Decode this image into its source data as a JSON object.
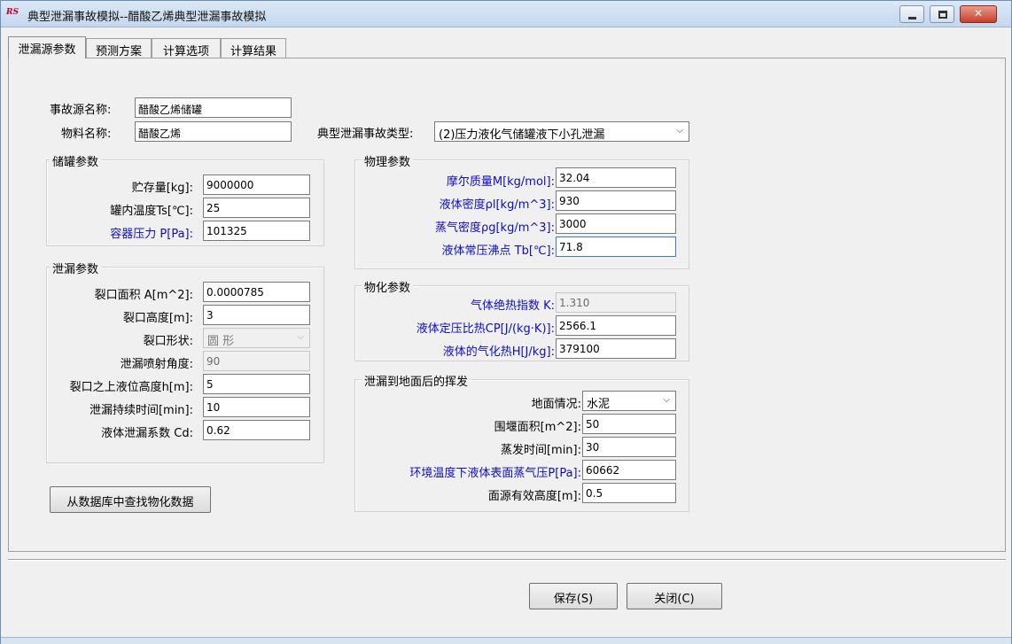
{
  "window": {
    "title": "典型泄漏事故模拟--醋酸乙烯典型泄漏事故模拟",
    "icon_text": "RS",
    "minimize_icon": "minimize-icon",
    "maximize_icon": "maximize-icon",
    "close_icon": "close-icon",
    "close_glyph": "✕"
  },
  "tabs": [
    {
      "label": "泄漏源参数",
      "active": true
    },
    {
      "label": "预测方案",
      "active": false
    },
    {
      "label": "计算选项",
      "active": false
    },
    {
      "label": "计算结果",
      "active": false
    }
  ],
  "source": {
    "name_label": "事故源名称:",
    "name_value": "醋酸乙烯储罐",
    "material_label": "物料名称:",
    "material_value": "醋酸乙烯",
    "accident_type_label": "典型泄漏事故类型:",
    "accident_type_value": "(2)压力液化气储罐液下小孔泄漏"
  },
  "tank": {
    "title": "储罐参数",
    "fields": [
      {
        "label": "贮存量[kg]:",
        "value": "9000000",
        "blue": false
      },
      {
        "label": "罐内温度Ts[℃]:",
        "value": "25",
        "blue": false
      },
      {
        "label": "容器压力 P[Pa]:",
        "value": "101325",
        "blue": true
      }
    ]
  },
  "leak": {
    "title": "泄漏参数",
    "fields": [
      {
        "label": "裂口面积 A[m^2]:",
        "value": "0.0000785"
      },
      {
        "label": "裂口高度[m]:",
        "value": "3"
      },
      {
        "label": "裂口形状:",
        "value": "圆  形"
      },
      {
        "label": "泄漏喷射角度:",
        "value": "90"
      },
      {
        "label": "裂口之上液位高度h[m]:",
        "value": "5"
      },
      {
        "label": "泄漏持续时间[min]:",
        "value": "10"
      },
      {
        "label": "液体泄漏系数  Cd:",
        "value": "0.62"
      }
    ]
  },
  "physical": {
    "title": "物理参数",
    "fields": [
      {
        "label": "摩尔质量M[kg/mol]:",
        "value": "32.04"
      },
      {
        "label": "液体密度ρl[kg/m^3]:",
        "value": "930"
      },
      {
        "label": "蒸气密度ρg[kg/m^3]:",
        "value": "3000"
      },
      {
        "label": "液体常压沸点 Tb[℃]:",
        "value": "71.8"
      }
    ]
  },
  "chemical": {
    "title": "物化参数",
    "fields": [
      {
        "label": "气体绝热指数  K:",
        "value": "1.310"
      },
      {
        "label": "液体定压比热CP[J/(kg·K)]:",
        "value": "2566.1"
      },
      {
        "label": "液体的气化热H[J/kg]:",
        "value": "379100"
      }
    ]
  },
  "evaporation": {
    "title": "泄漏到地面后的挥发",
    "fields": [
      {
        "label": "地面情况:",
        "value": "水泥",
        "blue": false
      },
      {
        "label": "围堰面积[m^2]:",
        "value": "50",
        "blue": false
      },
      {
        "label": "蒸发时间[min]:",
        "value": "30",
        "blue": false
      },
      {
        "label": "环境温度下液体表面蒸气压P[Pa]:",
        "value": "60662",
        "blue": true
      },
      {
        "label": "面源有效高度[m]:",
        "value": "0.5",
        "blue": false
      }
    ]
  },
  "buttons": {
    "lookup": "从数据库中查找物化数据",
    "save": "保存(S)",
    "close": "关闭(C)"
  },
  "colors": {
    "label_blue": "#0c0ccc",
    "titlebar": "#dbe8f6"
  }
}
